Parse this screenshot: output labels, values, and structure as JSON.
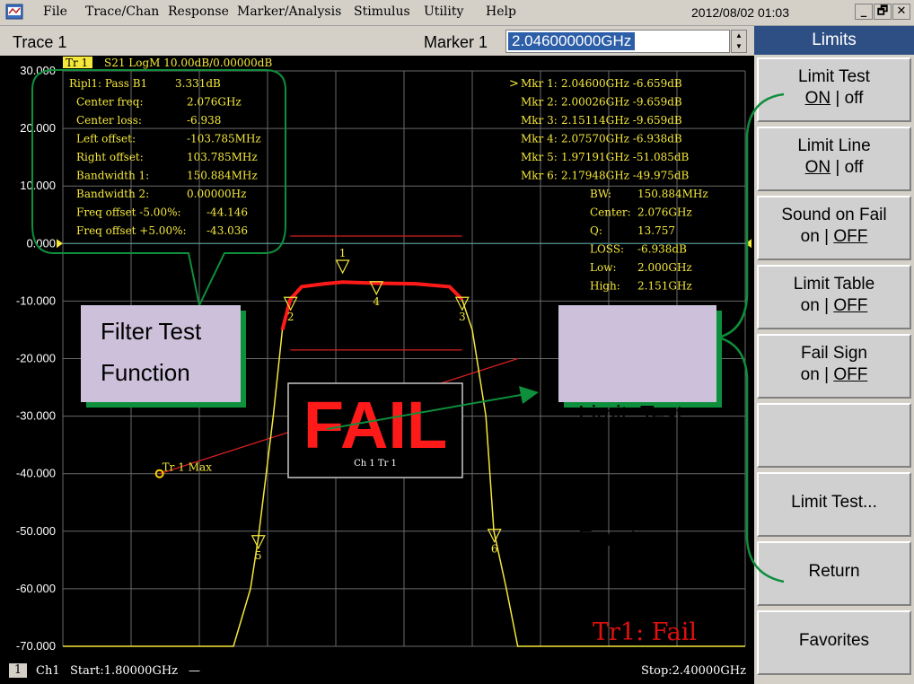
{
  "menubar": {
    "items": [
      "File",
      "Trace/Chan",
      "Response",
      "Marker/Analysis",
      "Stimulus",
      "Utility",
      "Help"
    ],
    "datetime": "2012/08/02 01:03",
    "window_buttons": [
      "_",
      "🗗",
      "✕"
    ]
  },
  "toolbar": {
    "trace": "Trace 1",
    "marker_label": "Marker 1",
    "marker_value": "2.046000000GHz"
  },
  "plot": {
    "trace_tag": "Tr 1",
    "trace_info": "S21 LogM 10.00dB/0.00000dB",
    "y_ticks": [
      "30.000",
      "20.000",
      "10.000",
      "0.000",
      "-10.000",
      "-20.000",
      "-30.000",
      "-40.000",
      "-50.000",
      "-60.000",
      "-70.000"
    ],
    "filter_results": [
      {
        "label": "Ripl1: Pass B1",
        "value": "3.331dB"
      },
      {
        "label": "Center freq:",
        "value": "2.076GHz"
      },
      {
        "label": "Center loss:",
        "value": "-6.938"
      },
      {
        "label": "Left offset:",
        "value": "-103.785MHz"
      },
      {
        "label": "Right offset:",
        "value": "103.785MHz"
      },
      {
        "label": "Bandwidth 1:",
        "value": "150.884MHz"
      },
      {
        "label": "Bandwidth 2:",
        "value": "0.00000Hz"
      },
      {
        "label": "Freq offset -5.00%:",
        "value": "-44.146"
      },
      {
        "label": "Freq offset +5.00%:",
        "value": "-43.036"
      }
    ],
    "marker_readouts": [
      {
        "label": "Mkr 1:",
        "value": "2.04600GHz -6.659dB"
      },
      {
        "label": "Mkr 2:",
        "value": "2.00026GHz -9.659dB"
      },
      {
        "label": "Mkr 3:",
        "value": "2.15114GHz -9.659dB"
      },
      {
        "label": "Mkr 4:",
        "value": "2.07570GHz -6.938dB"
      },
      {
        "label": "Mkr 5:",
        "value": "1.97191GHz -51.085dB"
      },
      {
        "label": "Mkr 6:",
        "value": "2.17948GHz -49.975dB"
      }
    ],
    "bw_stats": [
      {
        "label": "BW:",
        "value": "150.884MHz"
      },
      {
        "label": "Center:",
        "value": "2.076GHz"
      },
      {
        "label": "Q:",
        "value": "13.757"
      },
      {
        "label": "LOSS:",
        "value": "-6.938dB"
      },
      {
        "label": "Low:",
        "value": "2.000GHz"
      },
      {
        "label": "High:",
        "value": "2.151GHz"
      }
    ],
    "marker_numbers": [
      "1",
      "2",
      "3",
      "4",
      "5",
      "6"
    ],
    "max_marker": "Tr 1 Max",
    "fail_text": "FAIL",
    "fail_sub": "Ch 1 Tr 1",
    "trace_status": "Tr1: Fail",
    "callout_left": [
      "Filter Test",
      "Function"
    ],
    "callout_right": [
      "Limit  Test",
      "Function"
    ]
  },
  "chart_data": {
    "type": "line",
    "title": "",
    "xlabel": "",
    "ylabel": "",
    "x_range_ghz": [
      1.8,
      2.4
    ],
    "ylim": [
      -70,
      30
    ],
    "y_divisions": 10,
    "x_divisions": 10,
    "series": [
      {
        "x": [
          1.8,
          1.95,
          1.965,
          1.972,
          1.985,
          1.993,
          2.0,
          2.01,
          2.03,
          2.046,
          2.076,
          2.11,
          2.14,
          2.151,
          2.16,
          2.172,
          2.179,
          2.19,
          2.2,
          2.4
        ],
        "y": [
          -70,
          -70,
          -60,
          -51,
          -30,
          -15,
          -9.7,
          -7.5,
          -7.0,
          -6.7,
          -6.9,
          -7.0,
          -7.5,
          -9.7,
          -15,
          -30,
          -50,
          -60,
          -70,
          -70
        ]
      }
    ],
    "limit_lines": [
      {
        "x": [
          1.885,
          2.2
        ],
        "y": [
          -40,
          -20
        ]
      },
      {
        "x": [
          2.0,
          2.151
        ],
        "y": [
          1.3,
          1.3
        ]
      },
      {
        "x": [
          2.0,
          2.151
        ],
        "y": [
          -18.5,
          -18.5
        ]
      }
    ],
    "markers": [
      {
        "name": "1",
        "x": 2.046,
        "y": -6.659
      },
      {
        "name": "2",
        "x": 2.00026,
        "y": -9.659
      },
      {
        "name": "3",
        "x": 2.15114,
        "y": -9.659
      },
      {
        "name": "4",
        "x": 2.0757,
        "y": -6.938
      },
      {
        "name": "5",
        "x": 1.97191,
        "y": -51.085
      },
      {
        "name": "6",
        "x": 2.17948,
        "y": -49.975
      }
    ],
    "reference_level": 0
  },
  "status": {
    "channel_num": "1",
    "channel": "Ch1",
    "start": "Start:1.80000GHz",
    "start_line": "—",
    "stop": "Stop:2.40000GHz"
  },
  "softkeys": {
    "title": "Limits",
    "keys": [
      {
        "label": "Limit Test",
        "on": "ON",
        "sep": " | ",
        "off": "off",
        "active": "on"
      },
      {
        "label": "Limit Line",
        "on": "ON",
        "sep": " | ",
        "off": "off",
        "active": "on"
      },
      {
        "label": "Sound on Fail",
        "on": "on",
        "sep": " | ",
        "off": "OFF",
        "active": "off"
      },
      {
        "label": "Limit Table",
        "on": "on",
        "sep": " | ",
        "off": "OFF",
        "active": "off"
      },
      {
        "label": "Fail Sign",
        "on": "on",
        "sep": " | ",
        "off": "OFF",
        "active": "off"
      },
      {
        "label": "",
        "on": "",
        "sep": "",
        "off": "",
        "active": ""
      },
      {
        "label": "Limit Test...",
        "on": "",
        "sep": "",
        "off": "",
        "active": ""
      },
      {
        "label": "Return",
        "on": "",
        "sep": "",
        "off": "",
        "active": ""
      },
      {
        "label": "Favorites",
        "on": "",
        "sep": "",
        "off": "",
        "active": ""
      }
    ]
  },
  "colors": {
    "trace": "#f5e83a",
    "limit_fail": "#ff1a1a",
    "limit_line": "#d42020",
    "text": "#f5e83a",
    "grid": "#6a6a6a",
    "callout_bg": "#ccc0da",
    "callout_border": "#0e8f3c",
    "softkey_title": "#2e4f84"
  }
}
